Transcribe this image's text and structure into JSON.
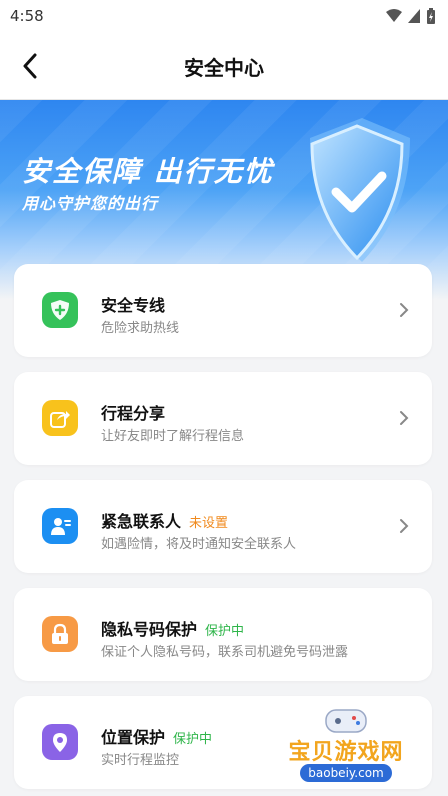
{
  "status_bar": {
    "time": "4:58"
  },
  "header": {
    "title": "安全中心"
  },
  "banner": {
    "title": "安全保障 出行无忧",
    "subtitle": "用心守护您的出行"
  },
  "cards": [
    {
      "title": "安全专线",
      "tag": "",
      "tag_color": "",
      "desc": "危险求助热线",
      "icon": "shield-plus-icon",
      "icon_color": "#35c25a"
    },
    {
      "title": "行程分享",
      "tag": "",
      "tag_color": "",
      "desc": "让好友即时了解行程信息",
      "icon": "share-icon",
      "icon_color": "#f8c21c"
    },
    {
      "title": "紧急联系人",
      "tag": "未设置",
      "tag_color": "#f08a1e",
      "desc": "如遇险情，将及时通知安全联系人",
      "icon": "contact-icon",
      "icon_color": "#1c8ff2"
    },
    {
      "title": "隐私号码保护",
      "tag": "保护中",
      "tag_color": "#2fb54a",
      "desc": "保证个人隐私号码，联系司机避免号码泄露",
      "icon": "lock-icon",
      "icon_color": "#f79a45"
    },
    {
      "title": "位置保护",
      "tag": "保护中",
      "tag_color": "#2fb54a",
      "desc": "实时行程监控",
      "icon": "location-pin-icon",
      "icon_color": "#8a63e6"
    }
  ],
  "watermark": {
    "text": "宝贝游戏网",
    "url": "baobeiy.com"
  }
}
